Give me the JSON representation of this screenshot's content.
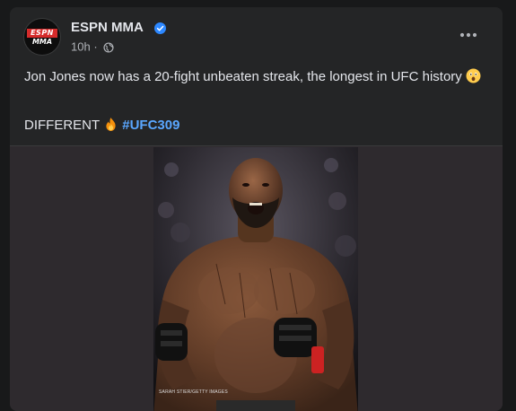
{
  "post": {
    "page_name": "ESPN MMA",
    "avatar": {
      "line1": "ESPN",
      "line2": "MMA"
    },
    "timestamp": "10h",
    "separator": "·",
    "text": "Jon Jones now has a 20-fight unbeaten streak, the longest in UFC history",
    "line2_text": "DIFFERENT",
    "hashtag": "#UFC309",
    "photo_credit": "SARAH STIER/GETTY IMAGES"
  },
  "icons": {
    "verified": "verified-badge-icon",
    "audience": "globe-icon",
    "more": "more-options-icon",
    "emoji_1": "astonished-face-emoji",
    "emoji_2": "fire-emoji"
  },
  "colors": {
    "background": "#18191a",
    "card": "#242526",
    "primary_text": "#e4e6eb",
    "secondary_text": "#b0b3b8",
    "hashtag": "#5aa7ff",
    "verified": "#2d88ff",
    "espn_red": "#d52b2b"
  }
}
